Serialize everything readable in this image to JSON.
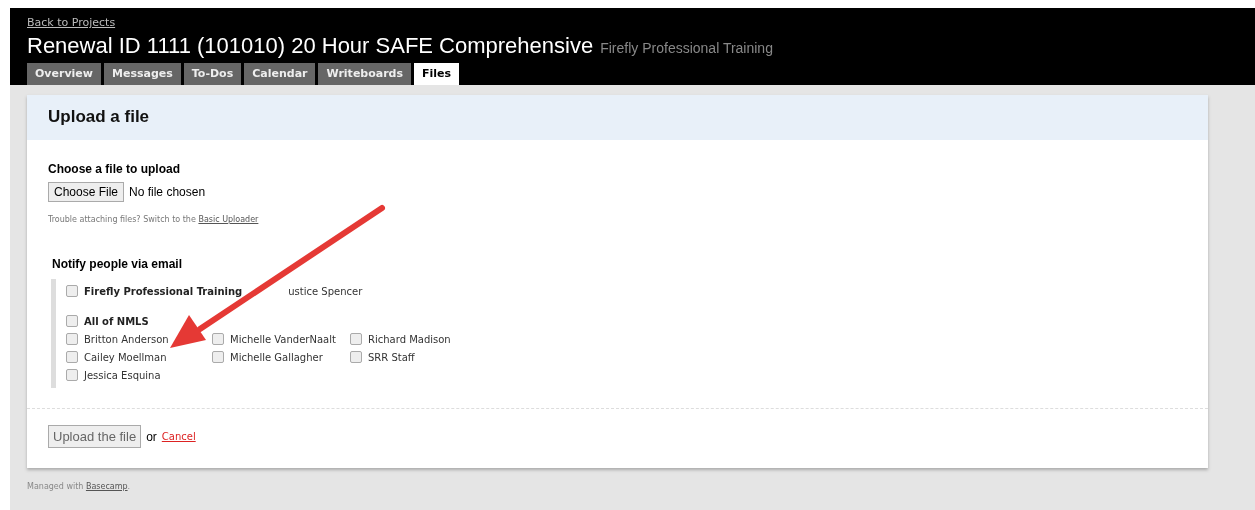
{
  "header": {
    "back_link": "Back to Projects",
    "title": "Renewal ID 1111 (101010) 20 Hour SAFE Comprehensive",
    "company": "Firefly Professional Training"
  },
  "tabs": [
    {
      "label": "Overview",
      "selected": false
    },
    {
      "label": "Messages",
      "selected": false
    },
    {
      "label": "To-Dos",
      "selected": false
    },
    {
      "label": "Calendar",
      "selected": false
    },
    {
      "label": "Writeboards",
      "selected": false
    },
    {
      "label": "Files",
      "selected": true
    }
  ],
  "panel": {
    "title": "Upload a file",
    "choose_label": "Choose a file to upload",
    "choose_button": "Choose File",
    "file_status": "No file chosen",
    "trouble_text": "Trouble attaching files? Switch to the",
    "trouble_link": "Basic Uploader",
    "notify_label": "Notify people via email",
    "groups": [
      {
        "name": "Firefly Professional Training",
        "checked": false,
        "member": "ustice Spencer"
      },
      {
        "name": "All of NMLS",
        "checked": false,
        "people": [
          {
            "name": "Britton Anderson",
            "checked": false
          },
          {
            "name": "Michelle VanderNaalt",
            "checked": false
          },
          {
            "name": "Richard Madison",
            "checked": false
          },
          {
            "name": "Cailey Moellman",
            "checked": false
          },
          {
            "name": "Michelle Gallagher",
            "checked": false
          },
          {
            "name": "SRR Staff",
            "checked": false
          },
          {
            "name": "Jessica Esquina",
            "checked": false
          }
        ]
      }
    ],
    "submit_button": "Upload the file",
    "or_text": "or",
    "cancel_link": "Cancel"
  },
  "footer": {
    "text": "Managed with",
    "link": "Basecamp",
    "suffix": "."
  }
}
